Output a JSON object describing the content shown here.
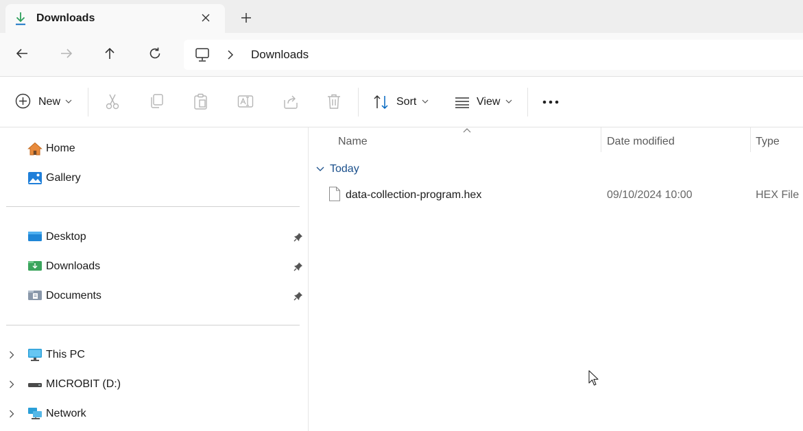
{
  "tab": {
    "title": "Downloads",
    "icon": "download-arrow-icon"
  },
  "address": {
    "crumb": "Downloads",
    "root_icon": "this-pc-icon"
  },
  "toolbar": {
    "new_label": "New",
    "sort_label": "Sort",
    "view_label": "View"
  },
  "sidebar": {
    "quick": [
      {
        "label": "Home",
        "icon": "home-icon"
      },
      {
        "label": "Gallery",
        "icon": "gallery-icon"
      }
    ],
    "pinned": [
      {
        "label": "Desktop",
        "icon": "desktop-folder-icon"
      },
      {
        "label": "Downloads",
        "icon": "downloads-folder-icon"
      },
      {
        "label": "Documents",
        "icon": "documents-folder-icon"
      }
    ],
    "locations": [
      {
        "label": "This PC",
        "icon": "this-pc-icon"
      },
      {
        "label": "MICROBIT (D:)",
        "icon": "drive-icon"
      },
      {
        "label": "Network",
        "icon": "network-icon"
      }
    ]
  },
  "list": {
    "columns": {
      "name": "Name",
      "date": "Date modified",
      "type": "Type"
    },
    "group": "Today",
    "files": [
      {
        "name": "data-collection-program.hex",
        "date": "09/10/2024 10:00",
        "type": "HEX File"
      }
    ]
  },
  "colors": {
    "accent": "#0067c0",
    "download_green": "#2d9f5b",
    "group_text": "#1a4f8b"
  }
}
